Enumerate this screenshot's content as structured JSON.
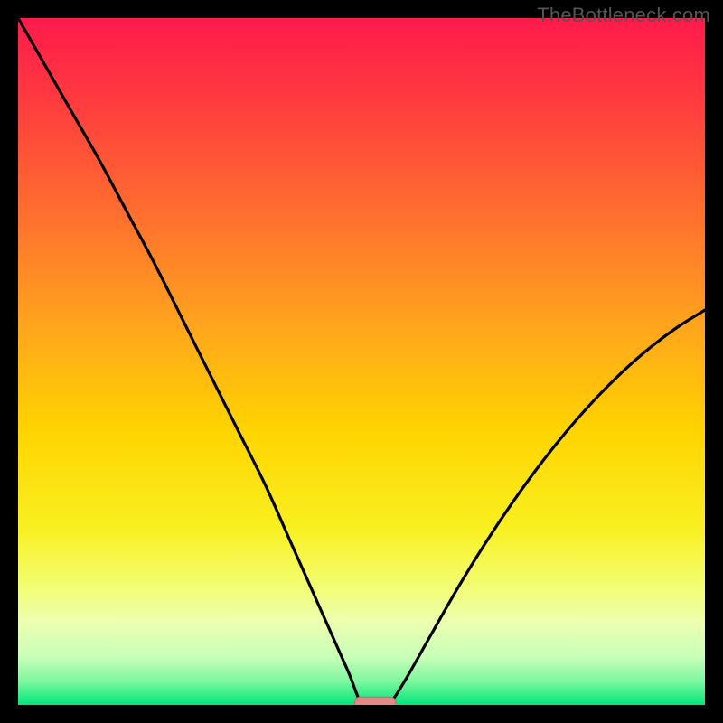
{
  "watermark": "TheBottleneck.com",
  "chart_data": {
    "type": "line",
    "title": "",
    "xlabel": "",
    "ylabel": "",
    "xlim": [
      0,
      100
    ],
    "ylim": [
      0,
      100
    ],
    "series": [
      {
        "name": "bottleneck-curve",
        "x": [
          0,
          4,
          8,
          12,
          16,
          20,
          24,
          28,
          32,
          36,
          40,
          44,
          48,
          50,
          52,
          54,
          56,
          60,
          64,
          68,
          72,
          76,
          80,
          84,
          88,
          92,
          96,
          100
        ],
        "values": [
          100,
          93,
          86,
          79,
          71.5,
          64,
          56,
          48,
          40,
          32,
          23,
          14,
          5,
          0.3,
          0.3,
          0.3,
          3,
          10,
          17,
          23.5,
          29.5,
          35,
          40,
          44.5,
          48.5,
          52,
          55,
          57.5
        ]
      }
    ],
    "marker": {
      "x_start": 49,
      "x_end": 55,
      "y": 0.3
    },
    "gradient_stops": [
      {
        "offset": 0.0,
        "color": "#ff1a4b"
      },
      {
        "offset": 0.12,
        "color": "#ff3b3f"
      },
      {
        "offset": 0.28,
        "color": "#ff6d2f"
      },
      {
        "offset": 0.44,
        "color": "#ffa21e"
      },
      {
        "offset": 0.6,
        "color": "#ffd400"
      },
      {
        "offset": 0.74,
        "color": "#f9ef20"
      },
      {
        "offset": 0.82,
        "color": "#f3fd6a"
      },
      {
        "offset": 0.88,
        "color": "#ecffb0"
      },
      {
        "offset": 0.93,
        "color": "#c8ffb8"
      },
      {
        "offset": 0.965,
        "color": "#7ff7a0"
      },
      {
        "offset": 1.0,
        "color": "#00e67a"
      }
    ],
    "curve_stroke": "#000000",
    "curve_width": 3.2,
    "marker_fill": "#e38a87",
    "marker_stroke": "#c96a68"
  }
}
